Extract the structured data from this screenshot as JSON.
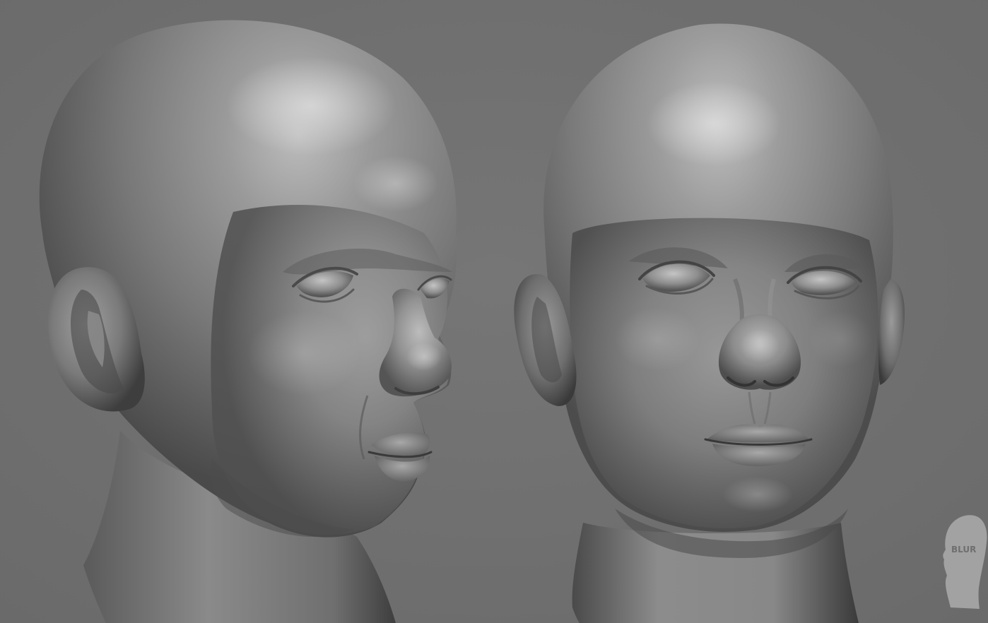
{
  "scene": {
    "background_color": "#6f6f6f",
    "sculpt_color": "#8a8a8a",
    "highlight_color": "#c8c8c8",
    "shadow_color": "#2e2e2e"
  },
  "watermark": {
    "text": "BLUR",
    "icon": "head-silhouette-icon"
  }
}
